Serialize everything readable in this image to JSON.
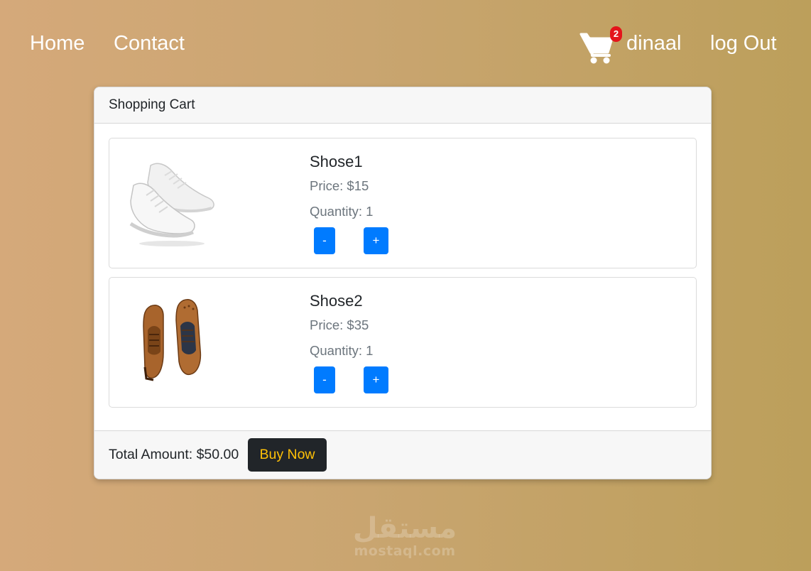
{
  "nav": {
    "home_label": "Home",
    "contact_label": "Contact",
    "cart_icon": "shopping-cart-icon",
    "cart_count": "2",
    "username": "dinaal",
    "logout_label": "log Out"
  },
  "cart": {
    "title": "Shopping Cart",
    "items": [
      {
        "name": "Shose1",
        "price": "Price: $15",
        "quantity": "Quantity: 1",
        "image": "white-sneakers-image",
        "minus_label": "-",
        "plus_label": "+"
      },
      {
        "name": "Shose2",
        "price": "Price: $35",
        "quantity": "Quantity: 1",
        "image": "brown-leather-brogues-image",
        "minus_label": "-",
        "plus_label": "+"
      }
    ],
    "total": "Total Amount: $50.00",
    "buy_label": "Buy Now"
  },
  "watermark": {
    "arabic": "مستقل",
    "latin": "mostaql.com"
  },
  "colors": {
    "primary": "#007bff",
    "dark": "#212529",
    "warning": "#ffc107",
    "badge": "#e4141b",
    "background_start": "#d5a97a",
    "background_end": "#bc9f5b"
  }
}
